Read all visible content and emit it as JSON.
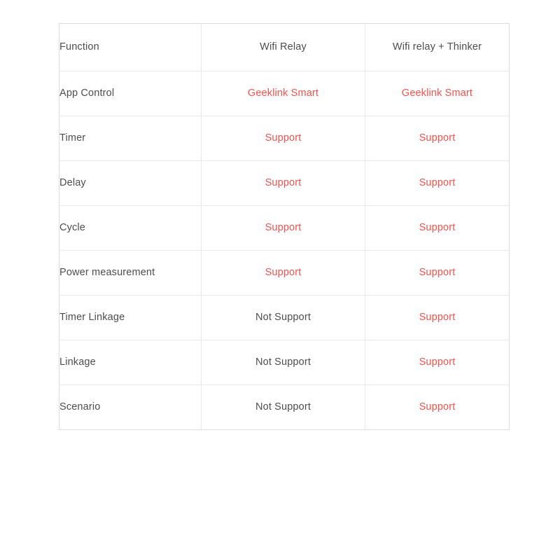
{
  "table": {
    "headers": {
      "function": "Function",
      "column_a": "Wifi Relay",
      "column_b": "Wifi relay + Thinker"
    },
    "colors": {
      "supported_text": "#f9504a",
      "normal_text": "#4d4d4d",
      "border": "#e8e8e8",
      "outer_border": "#dcdcdc",
      "background": "#ffffff"
    },
    "rows": [
      {
        "function": "App Control",
        "column_a": "Geeklink Smart",
        "column_b": "Geeklink Smart",
        "a_supported": true,
        "b_supported": true
      },
      {
        "function": "Timer",
        "column_a": "Support",
        "column_b": "Support",
        "a_supported": true,
        "b_supported": true
      },
      {
        "function": "Delay",
        "column_a": "Support",
        "column_b": "Support",
        "a_supported": true,
        "b_supported": true
      },
      {
        "function": "Cycle",
        "column_a": "Support",
        "column_b": "Support",
        "a_supported": true,
        "b_supported": true
      },
      {
        "function": "Power measurement",
        "column_a": "Support",
        "column_b": "Support",
        "a_supported": true,
        "b_supported": true
      },
      {
        "function": "Timer Linkage",
        "column_a": "Not Support",
        "column_b": "Support",
        "a_supported": false,
        "b_supported": true
      },
      {
        "function": "Linkage",
        "column_a": "Not Support",
        "column_b": "Support",
        "a_supported": false,
        "b_supported": true
      },
      {
        "function": "Scenario",
        "column_a": "Not Support",
        "column_b": "Support",
        "a_supported": false,
        "b_supported": true
      }
    ]
  }
}
